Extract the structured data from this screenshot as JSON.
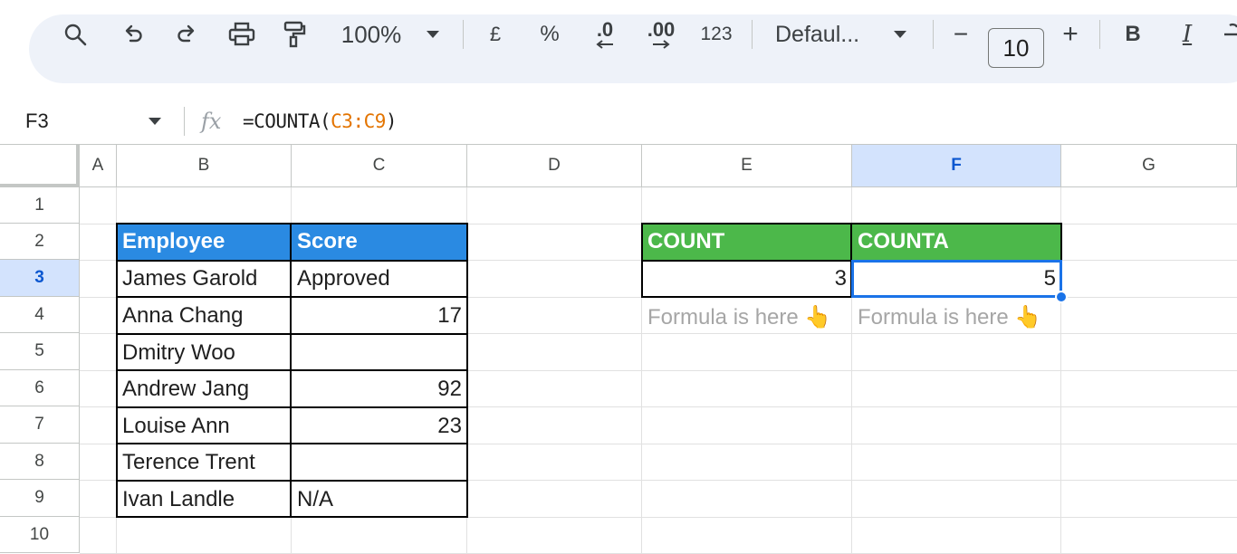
{
  "toolbar": {
    "zoom": "100%",
    "currency_label": "£",
    "percent_label": "%",
    "decrease_decimals_label": ".0",
    "increase_decimals_label": ".00",
    "number_format_label": "123",
    "font_name": "Defaul...",
    "font_size": "10",
    "minus_label": "−",
    "plus_label": "+",
    "bold_label": "B",
    "italic_label": "I"
  },
  "formula_bar": {
    "name_box": "F3",
    "fx_label": "fx",
    "formula_prefix": "=COUNTA(",
    "formula_ref": "C3:C9",
    "formula_suffix": ")"
  },
  "columns": [
    "A",
    "B",
    "C",
    "D",
    "E",
    "F",
    "G"
  ],
  "selected_column": "F",
  "rows": [
    "1",
    "2",
    "3",
    "4",
    "5",
    "6",
    "7",
    "8",
    "9",
    "10"
  ],
  "selected_row": "3",
  "table": {
    "header_employee": "Employee",
    "header_score": "Score",
    "rows": [
      {
        "employee": "James Garold",
        "score": "Approved"
      },
      {
        "employee": "Anna Chang",
        "score": "17"
      },
      {
        "employee": "Dmitry Woo",
        "score": ""
      },
      {
        "employee": "Andrew Jang",
        "score": "92"
      },
      {
        "employee": "Louise Ann",
        "score": "23"
      },
      {
        "employee": "Terence Trent",
        "score": ""
      },
      {
        "employee": "Ivan Landle",
        "score": "N/A"
      }
    ]
  },
  "results": {
    "count_header": "COUNT",
    "counta_header": "COUNTA",
    "count_value": "3",
    "counta_value": "5",
    "count_note": "Formula is here 👆",
    "counta_note": "Formula is here 👆"
  },
  "colors": {
    "blue_header": "#2a8ae2",
    "green_header": "#4cb84a",
    "selection": "#1a73e8",
    "formula_ref": "#e37400"
  }
}
